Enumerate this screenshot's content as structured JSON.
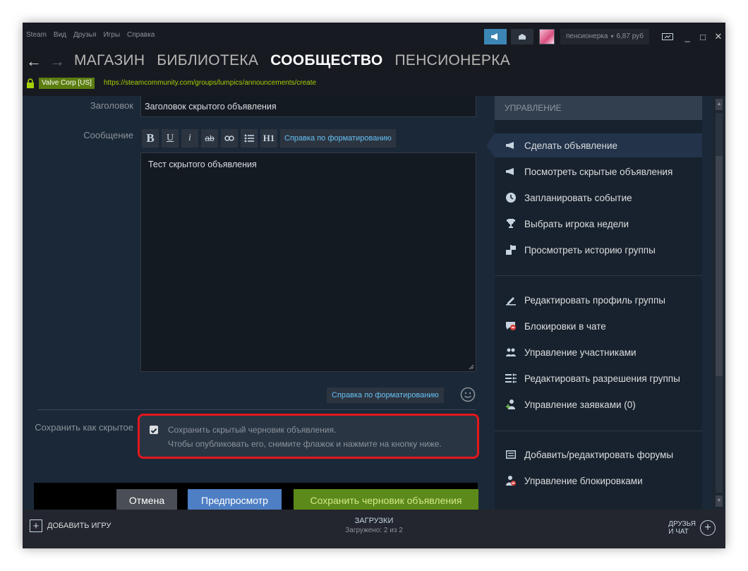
{
  "menu": [
    "Steam",
    "Вид",
    "Друзья",
    "Игры",
    "Справка"
  ],
  "topbar": {
    "username": "пенсионерка",
    "balance": "6,87 руб"
  },
  "nav": {
    "back": "←",
    "forward": "→",
    "store": "МАГАЗИН",
    "library": "БИБЛИОТЕКА",
    "community": "СООБЩЕСТВО",
    "profile": "ПЕНСИОНЕРКА"
  },
  "urlbar": {
    "cert": "Valve Corp [US]",
    "url": "https://steamcommunity.com/groups/lumpics/announcements/create"
  },
  "form": {
    "title_label": "Заголовок",
    "title_value": "Заголовок скрытого объявления",
    "message_label": "Сообщение",
    "toolbar": {
      "bold": "B",
      "underline": "U",
      "italic": "i",
      "strike": "ab",
      "h1": "H1",
      "help": "Справка по форматированию"
    },
    "message_value": "Тест скрытого объявления",
    "help_bottom": "Справка по форматированию",
    "hidden_label": "Сохранить как скрытое",
    "hidden_checked": true,
    "hidden_line1": "Сохранить скрытый черновик объявления.",
    "hidden_line2": "Чтобы опубликовать его, снимите флажок и нажмите на кнопку ниже.",
    "cancel": "Отмена",
    "preview": "Предпросмотр",
    "save": "Сохранить черновик объявления"
  },
  "panel": {
    "header": "УПРАВЛЕНИЕ",
    "group1": [
      {
        "label": "Сделать объявление",
        "icon": "megaphone-icon",
        "active": true
      },
      {
        "label": "Посмотреть скрытые объявления",
        "icon": "megaphone-icon"
      },
      {
        "label": "Запланировать событие",
        "icon": "clock-icon"
      },
      {
        "label": "Выбрать игрока недели",
        "icon": "trophy-icon"
      },
      {
        "label": "Просмотреть историю группы",
        "icon": "history-icon"
      }
    ],
    "group2": [
      {
        "label": "Редактировать профиль группы",
        "icon": "pencil-icon"
      },
      {
        "label": "Блокировки в чате",
        "icon": "chat-ban-icon"
      },
      {
        "label": "Управление участниками",
        "icon": "members-icon"
      },
      {
        "label": "Редактировать разрешения группы",
        "icon": "permissions-icon"
      },
      {
        "label": "Управление заявками (0)",
        "icon": "add-user-icon"
      }
    ],
    "group3": [
      {
        "label": "Добавить/редактировать форумы",
        "icon": "forum-icon"
      },
      {
        "label": "Управление блокировками",
        "icon": "ban-user-icon"
      }
    ]
  },
  "bottom": {
    "add_game": "ДОБАВИТЬ ИГРУ",
    "downloads_title": "ЗАГРУЗКИ",
    "downloads_status": "Загружено: 2 из 2",
    "friends_line1": "ДРУЗЬЯ",
    "friends_line2": "И ЧАТ"
  },
  "colors": {
    "accent_blue": "#66c0f4",
    "save_green": "#5c8a1a",
    "highlight_red": "#e3171c",
    "url_green": "#a4d007"
  }
}
